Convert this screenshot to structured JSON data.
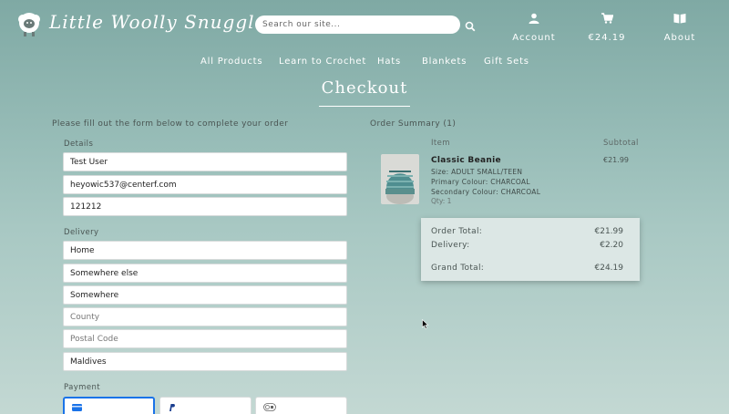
{
  "header": {
    "brand": "Little Woolly Snuggles",
    "search_placeholder": "Search our site...",
    "account_label": "Account",
    "bag_total": "€24.19",
    "about_label": "About"
  },
  "nav": {
    "items": [
      "All Products",
      "Learn to Crochet",
      "Hats",
      "Blankets",
      "Gift Sets"
    ]
  },
  "page": {
    "title": "Checkout",
    "intro": "Please fill out the form below to complete your order"
  },
  "form": {
    "details_label": "Details",
    "full_name": "Test User",
    "email": "heyowic537@centerf.com",
    "phone": "121212",
    "delivery_label": "Delivery",
    "address1": "Home",
    "address2": "Somewhere else",
    "town": "Somewhere",
    "county_placeholder": "County",
    "postcode_placeholder": "Postal Code",
    "country": "Maldives",
    "payment_label": "Payment"
  },
  "summary": {
    "heading": "Order Summary (1)",
    "col_item": "Item",
    "col_subtotal": "Subtotal",
    "item": {
      "name": "Classic Beanie",
      "size": "Size: ADULT SMALL/TEEN",
      "primary": "Primary Colour: CHARCOAL",
      "secondary": "Secondary Colour: CHARCOAL",
      "qty": "Qty: 1",
      "subtotal": "€21.99"
    },
    "order_total_label": "Order Total:",
    "order_total": "€21.99",
    "delivery_label": "Delivery:",
    "delivery": "€2.20",
    "grand_total_label": "Grand Total:",
    "grand_total": "€24.19"
  },
  "colors": {
    "accent_blue": "#1a73e8",
    "totals_bg": "#dce7e5"
  }
}
